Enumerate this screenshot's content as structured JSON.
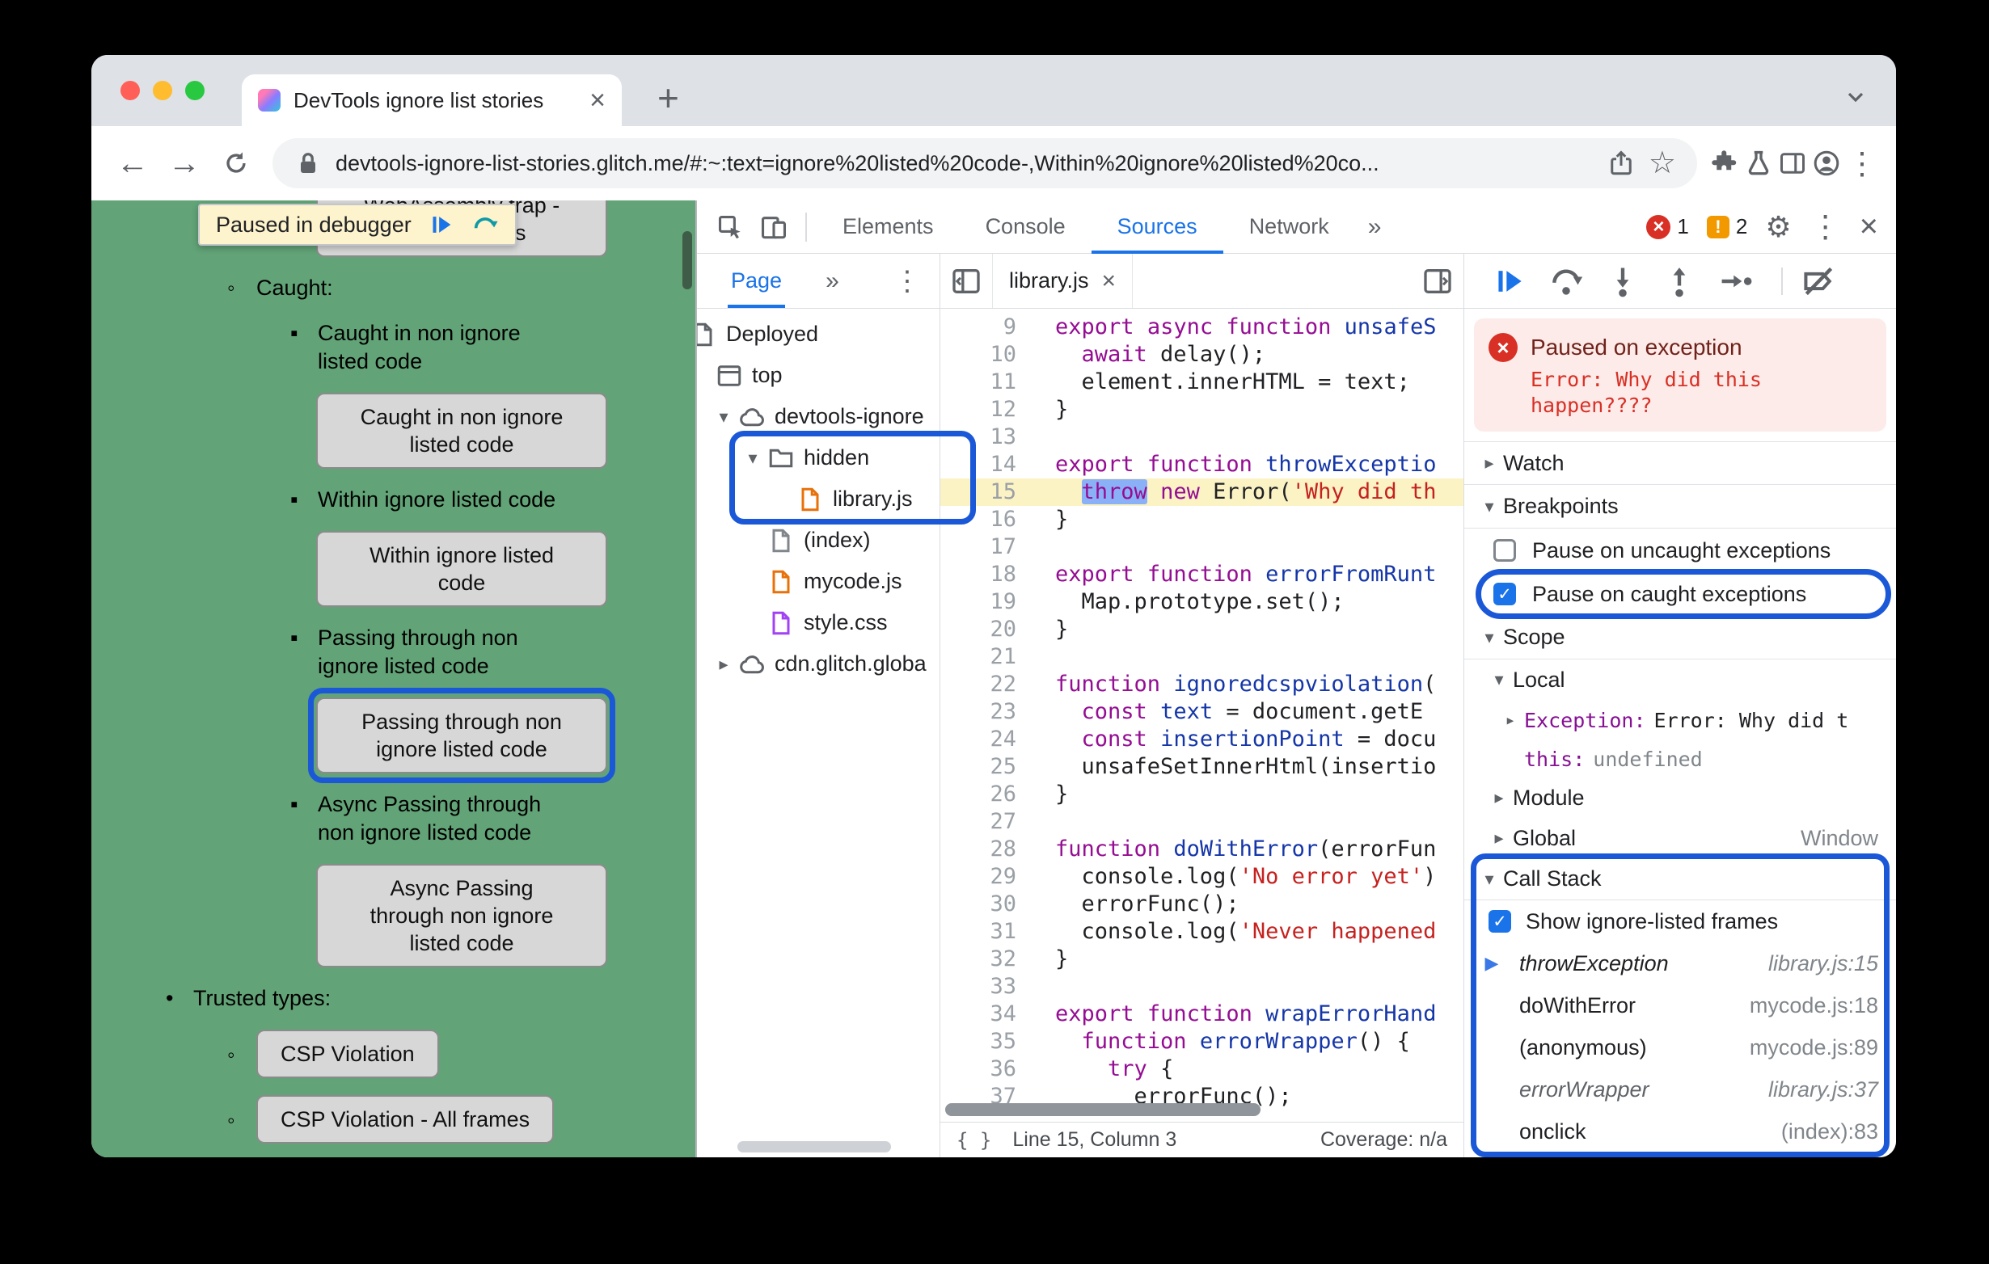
{
  "annotation_ring_color": "#1a58d8",
  "browser": {
    "tab": {
      "title": "DevTools ignore list stories"
    },
    "url": "devtools-ignore-list-stories.glitch.me/#:~:text=ignore%20listed%20code-,Within%20ignore%20listed%20co...",
    "new_tab_label": "+"
  },
  "page": {
    "background": "#62a377",
    "paused_overlay": "Paused in debugger",
    "blocks": [
      {
        "kind": "button",
        "level": 3,
        "bullet": "▪",
        "cut_top": true,
        "lines": [
          "WebAssembly trap -",
          "no JS frames"
        ]
      },
      {
        "kind": "text",
        "level": 2,
        "bullet": "◦",
        "lines": [
          "Caught:"
        ]
      },
      {
        "kind": "text",
        "level": 3,
        "bullet": "▪",
        "lines": [
          "Caught in non ignore",
          "listed code"
        ]
      },
      {
        "kind": "button",
        "level": 3,
        "lines": [
          "Caught in non ignore",
          "listed code"
        ]
      },
      {
        "kind": "text",
        "level": 3,
        "bullet": "▪",
        "lines": [
          "Within ignore listed code"
        ]
      },
      {
        "kind": "button",
        "level": 3,
        "lines": [
          "Within ignore listed",
          "code"
        ]
      },
      {
        "kind": "text",
        "level": 3,
        "bullet": "▪",
        "lines": [
          "Passing through non",
          "ignore listed code"
        ]
      },
      {
        "kind": "button",
        "level": 3,
        "ring": true,
        "lines": [
          "Passing through non",
          "ignore listed code"
        ]
      },
      {
        "kind": "text",
        "level": 3,
        "bullet": "▪",
        "lines": [
          "Async Passing through",
          "non ignore listed code"
        ]
      },
      {
        "kind": "button",
        "level": 3,
        "lines": [
          "Async Passing",
          "through non ignore",
          "listed code"
        ]
      },
      {
        "kind": "text",
        "level": 1,
        "bullet": "•",
        "lines": [
          "Trusted types:"
        ]
      },
      {
        "kind": "button",
        "level": 2,
        "bullet": "◦",
        "inline": true,
        "lines": [
          "CSP Violation"
        ]
      },
      {
        "kind": "button",
        "level": 2,
        "bullet": "◦",
        "inline": true,
        "lines": [
          "CSP Violation - All frames"
        ]
      }
    ]
  },
  "devtools": {
    "main_tabs": [
      "Elements",
      "Console",
      "Sources",
      "Network"
    ],
    "active_tab": "Sources",
    "more_tabs": "»",
    "error_count": "1",
    "issue_count": "2",
    "navigator": {
      "header": "Page",
      "more": "»",
      "tree": [
        {
          "label": "Deployed",
          "icon": "deployed",
          "indent": 0,
          "flush": true,
          "cut": true
        },
        {
          "label": "top",
          "icon": "frame",
          "indent": 0,
          "flush": true
        },
        {
          "label": "devtools-ignore",
          "icon": "cloud",
          "indent": 0,
          "arrow": "▾"
        },
        {
          "label": "hidden",
          "icon": "folder",
          "indent": 1,
          "arrow": "▾"
        },
        {
          "label": "library.js",
          "icon": "file-js",
          "indent": 2
        },
        {
          "label": "(index)",
          "icon": "file-plain",
          "indent": 1
        },
        {
          "label": "mycode.js",
          "icon": "file-js",
          "indent": 1
        },
        {
          "label": "style.css",
          "icon": "file-css",
          "indent": 1
        },
        {
          "label": "cdn.glitch.globa",
          "icon": "cloud",
          "indent": 0,
          "arrow": "▸"
        }
      ]
    },
    "editor": {
      "tab": "library.js",
      "current_line": 15,
      "status_line": "Line 15, Column 3",
      "status_coverage": "Coverage: n/a",
      "lines": [
        {
          "n": 9,
          "seg": [
            [
              "k",
              "export"
            ],
            [
              "t",
              " "
            ],
            [
              "k",
              "async"
            ],
            [
              "t",
              " "
            ],
            [
              "k",
              "function"
            ],
            [
              "t",
              " "
            ],
            [
              "f",
              "unsafeS"
            ]
          ]
        },
        {
          "n": 10,
          "seg": [
            [
              "t",
              "  "
            ],
            [
              "k",
              "await"
            ],
            [
              "t",
              " delay();"
            ]
          ]
        },
        {
          "n": 11,
          "seg": [
            [
              "t",
              "  element.innerHTML = text;"
            ]
          ]
        },
        {
          "n": 12,
          "seg": [
            [
              "t",
              "}"
            ]
          ]
        },
        {
          "n": 13,
          "seg": []
        },
        {
          "n": 14,
          "seg": [
            [
              "k",
              "export"
            ],
            [
              "t",
              " "
            ],
            [
              "k",
              "function"
            ],
            [
              "t",
              " "
            ],
            [
              "f",
              "throwExceptio"
            ]
          ]
        },
        {
          "n": 15,
          "seg": [
            [
              "t",
              "  "
            ],
            [
              "p",
              "throw"
            ],
            [
              "t",
              " "
            ],
            [
              "k",
              "new"
            ],
            [
              "t",
              " Error("
            ],
            [
              "s",
              "'Why did th"
            ]
          ]
        },
        {
          "n": 16,
          "seg": [
            [
              "t",
              "}"
            ]
          ]
        },
        {
          "n": 17,
          "seg": []
        },
        {
          "n": 18,
          "seg": [
            [
              "k",
              "export"
            ],
            [
              "t",
              " "
            ],
            [
              "k",
              "function"
            ],
            [
              "t",
              " "
            ],
            [
              "f",
              "errorFromRunt"
            ]
          ]
        },
        {
          "n": 19,
          "seg": [
            [
              "t",
              "  Map.prototype.set();"
            ]
          ]
        },
        {
          "n": 20,
          "seg": [
            [
              "t",
              "}"
            ]
          ]
        },
        {
          "n": 21,
          "seg": []
        },
        {
          "n": 22,
          "seg": [
            [
              "k",
              "function"
            ],
            [
              "t",
              " "
            ],
            [
              "f",
              "ignoredcspviolation"
            ],
            [
              "t",
              "("
            ]
          ]
        },
        {
          "n": 23,
          "seg": [
            [
              "t",
              "  "
            ],
            [
              "k",
              "const"
            ],
            [
              "t",
              " "
            ],
            [
              "v",
              "text"
            ],
            [
              "t",
              " = document.getE"
            ]
          ]
        },
        {
          "n": 24,
          "seg": [
            [
              "t",
              "  "
            ],
            [
              "k",
              "const"
            ],
            [
              "t",
              " "
            ],
            [
              "v",
              "insertionPoint"
            ],
            [
              "t",
              " = docu"
            ]
          ]
        },
        {
          "n": 25,
          "seg": [
            [
              "t",
              "  unsafeSetInnerHtml(insertio"
            ]
          ]
        },
        {
          "n": 26,
          "seg": [
            [
              "t",
              "}"
            ]
          ]
        },
        {
          "n": 27,
          "seg": []
        },
        {
          "n": 28,
          "seg": [
            [
              "k",
              "function"
            ],
            [
              "t",
              " "
            ],
            [
              "f",
              "doWithError"
            ],
            [
              "t",
              "(errorFun"
            ]
          ]
        },
        {
          "n": 29,
          "seg": [
            [
              "t",
              "  console.log("
            ],
            [
              "s",
              "'No error yet'"
            ],
            [
              "t",
              ")"
            ]
          ]
        },
        {
          "n": 30,
          "seg": [
            [
              "t",
              "  errorFunc();"
            ]
          ]
        },
        {
          "n": 31,
          "seg": [
            [
              "t",
              "  console.log("
            ],
            [
              "s",
              "'Never happened"
            ]
          ]
        },
        {
          "n": 32,
          "seg": [
            [
              "t",
              "}"
            ]
          ]
        },
        {
          "n": 33,
          "seg": []
        },
        {
          "n": 34,
          "seg": [
            [
              "k",
              "export"
            ],
            [
              "t",
              " "
            ],
            [
              "k",
              "function"
            ],
            [
              "t",
              " "
            ],
            [
              "f",
              "wrapErrorHand"
            ]
          ]
        },
        {
          "n": 35,
          "seg": [
            [
              "t",
              "  "
            ],
            [
              "k",
              "function"
            ],
            [
              "t",
              " "
            ],
            [
              "f",
              "errorWrapper"
            ],
            [
              "t",
              "() {"
            ]
          ]
        },
        {
          "n": 36,
          "seg": [
            [
              "t",
              "    "
            ],
            [
              "k",
              "try"
            ],
            [
              "t",
              " {"
            ]
          ]
        },
        {
          "n": 37,
          "seg": [
            [
              "t",
              "      errorFunc();"
            ]
          ]
        }
      ]
    },
    "debugger": {
      "paused_title": "Paused on exception",
      "paused_message": "Error: Why did this happen????",
      "watch_label": "Watch",
      "breakpoints_label": "Breakpoints",
      "breakpoints": [
        {
          "label": "Pause on uncaught exceptions",
          "checked": false
        },
        {
          "label": "Pause on caught exceptions",
          "checked": true,
          "ring": true
        }
      ],
      "scope_label": "Scope",
      "scope": [
        {
          "kind": "group",
          "arrow": "▾",
          "label": "Local"
        },
        {
          "kind": "prop",
          "arrow": "▸",
          "name": "Exception",
          "value": "Error: Why did t"
        },
        {
          "kind": "prop",
          "name": "this",
          "value": "undefined",
          "muted": true,
          "small": true
        },
        {
          "kind": "group",
          "arrow": "▸",
          "label": "Module"
        },
        {
          "kind": "group",
          "arrow": "▸",
          "label": "Global",
          "right": "Window"
        }
      ],
      "callstack_label": "Call Stack",
      "callstack_toggle": "Show ignore-listed frames",
      "frames": [
        {
          "name": "throwException",
          "loc": "library.js:15",
          "active": true,
          "ignored": true
        },
        {
          "name": "doWithError",
          "loc": "mycode.js:18"
        },
        {
          "name": "(anonymous)",
          "loc": "mycode.js:89"
        },
        {
          "name": "errorWrapper",
          "loc": "library.js:37",
          "ignored": true
        },
        {
          "name": "onclick",
          "loc": "(index):83"
        }
      ]
    }
  }
}
